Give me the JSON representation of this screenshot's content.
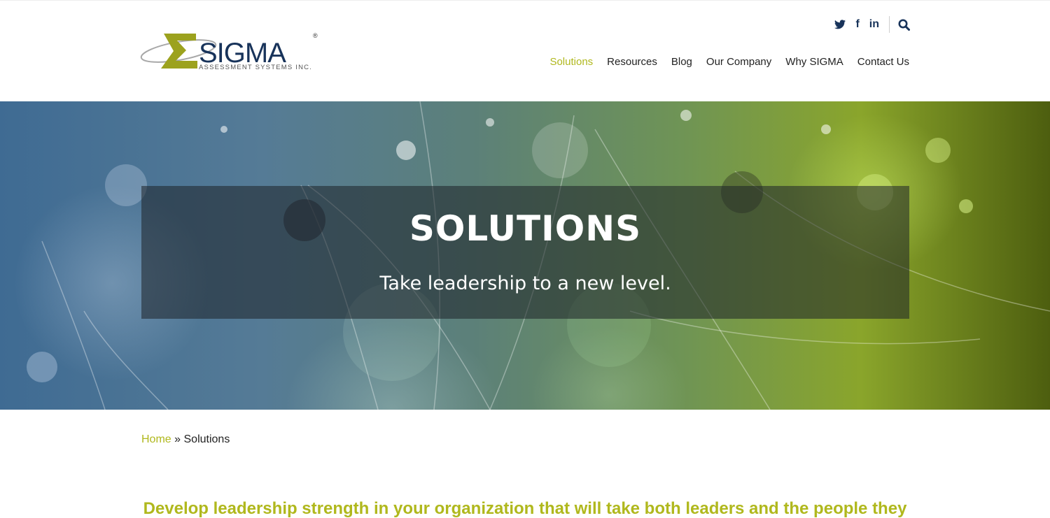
{
  "brand": {
    "logo_text": "SIGMA",
    "logo_subtext": "ASSESSMENT SYSTEMS INC.",
    "registered_mark": "®",
    "accent_color": "#b0b81d",
    "dark_color": "#18335a"
  },
  "social": {
    "twitter_glyph": "🐦",
    "facebook_glyph": "f",
    "linkedin_glyph": "in"
  },
  "nav": {
    "items": [
      {
        "label": "Solutions",
        "active": true
      },
      {
        "label": "Resources",
        "active": false
      },
      {
        "label": "Blog",
        "active": false
      },
      {
        "label": "Our Company",
        "active": false
      },
      {
        "label": "Why SIGMA",
        "active": false
      },
      {
        "label": "Contact Us",
        "active": false
      }
    ]
  },
  "hero": {
    "title": "SOLUTIONS",
    "subtitle": "Take leadership to a new level."
  },
  "breadcrumb": {
    "home": "Home",
    "separator": "»",
    "current": "Solutions"
  },
  "intro": {
    "text": "Develop leadership strength in your organization that will take both leaders and the people they"
  }
}
